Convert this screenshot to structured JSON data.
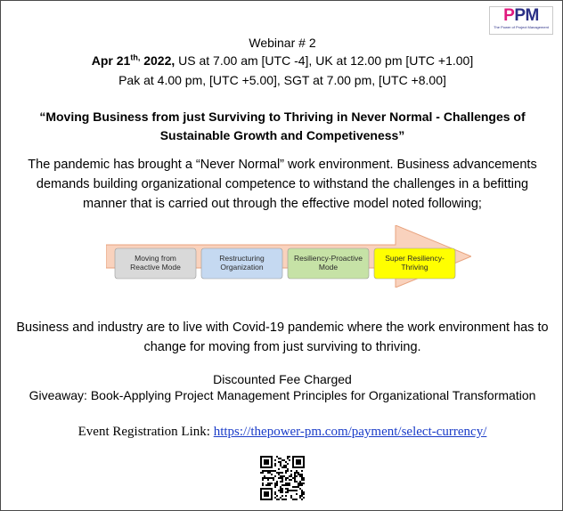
{
  "logo": {
    "mark_accent": "P",
    "mark_rest": "PM",
    "tagline": "The Power of Project Management"
  },
  "webinar": "Webinar # 2",
  "schedule": {
    "date_main": "Apr 21",
    "date_sup": "th,",
    "year": " 2022,",
    "line1_rest": " US at 7.00 am [UTC -4], UK at 12.00 pm [UTC +1.00]",
    "line2": "Pak at 4.00 pm, [UTC +5.00], SGT at 7.00 pm, [UTC +8.00]"
  },
  "title": "“Moving Business from just Surviving to Thriving in Never Normal - Challenges of Sustainable Growth and Competiveness”",
  "intro": "The pandemic has brought a “Never Normal” work environment. Business advancements demands building organizational competence to withstand the challenges in a befitting manner that is carried out through the effective model noted following;",
  "model": {
    "steps": [
      {
        "line1": "Moving from",
        "line2": "Reactive Mode",
        "color": "#d9d9d9"
      },
      {
        "line1": "Restructuring",
        "line2": "Organization",
        "color": "#c5d9f1"
      },
      {
        "line1": "Resiliency-Proactive",
        "line2": "Mode",
        "color": "#c6e2a6"
      },
      {
        "line1": "Super Resiliency-",
        "line2": "Thriving",
        "color": "#ffff00"
      }
    ],
    "arrow_color": "#f9d2bd",
    "arrow_border": "#e8a37e"
  },
  "covid_text": "Business and industry are to live with Covid-19 pandemic where the work environment has to change for moving from just surviving to thriving.",
  "fee": "Discounted Fee Charged",
  "giveaway": "Giveaway: Book-Applying Project Management Principles for Organizational Transformation",
  "registration": {
    "label": "Event Registration Link: ",
    "url": "https://thepower-pm.com/payment/select-currency/"
  }
}
